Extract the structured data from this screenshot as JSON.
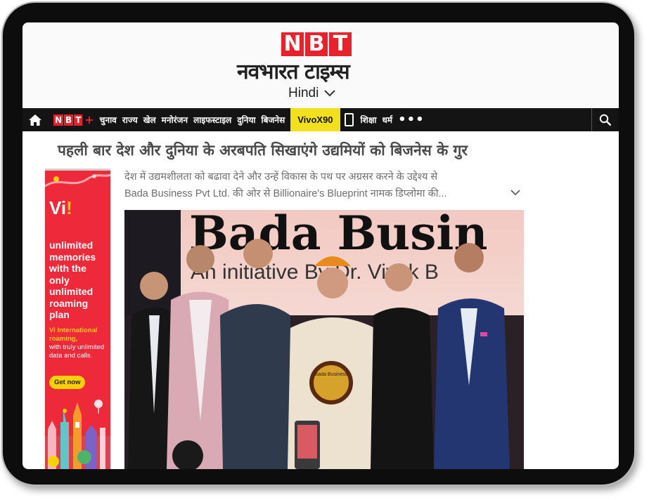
{
  "header": {
    "logo_letters": [
      "N",
      "B",
      "T"
    ],
    "logo_hindi": "नवभारत टाइम्स",
    "edition_label": "Hindi"
  },
  "nav": {
    "nbt_plus_letters": [
      "N",
      "B",
      "T"
    ],
    "nbt_plus_symbol": "+",
    "items": [
      "चुनाव",
      "राज्य",
      "खेल",
      "मनोरंजन",
      "लाइफस्टाइल",
      "दुनिया",
      "बिजनेस"
    ],
    "promo": "VivoX90",
    "items_after": [
      "शिक्षा",
      "धर्म"
    ],
    "more": "•••"
  },
  "article": {
    "headline": "पहली बार देश और दुनिया के अरबपति सिखाएंगे उद्यमियों को बिजनेस के गुर",
    "summary_line1": "देश में उद्यमशीलता को बढावा देने और उन्हें विकास के पथ पर अग्रसर करने के उद्देश्य से",
    "summary_line2": "Bada Business Pvt Ltd. की ओर से Billionaire's Blueprint नामक डिप्लोमा की...",
    "photo_banner_line1": "Bada Busin",
    "photo_banner_line2": "An initiative By Dr. Vivek B",
    "photo_plaque_text": "Bada Business"
  },
  "ad": {
    "brand": "Vi",
    "headline": "unlimited memories with the only unlimited roaming plan",
    "sub1": "Vi International roaming,",
    "sub2": "with truly unlimited data and calls.",
    "cta": "Get now"
  },
  "colors": {
    "brand_red": "#e8212b",
    "nav_bg": "#141414",
    "promo_yellow": "#f2e11a",
    "ad_red": "#ee2a3a",
    "ad_yellow": "#f9d000"
  },
  "icons": {
    "home": "home-icon",
    "search": "search-icon",
    "edition": "chevron-down-icon",
    "expand": "chevron-down-icon",
    "phone": "phone-icon"
  }
}
